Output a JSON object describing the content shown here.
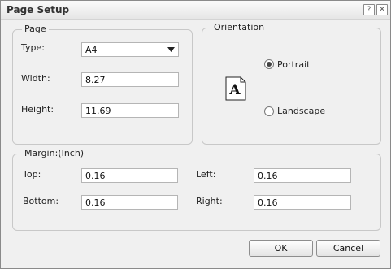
{
  "dialog": {
    "title": "Page Setup",
    "help_icon": "question-icon",
    "close_icon": "close-icon",
    "help_glyph": "?",
    "close_glyph": "✕"
  },
  "page": {
    "legend": "Page",
    "type_label": "Type:",
    "type_value": "A4",
    "type_options": [
      "A4"
    ],
    "width_label": "Width:",
    "width_value": "8.27",
    "height_label": "Height:",
    "height_value": "11.69"
  },
  "orientation": {
    "legend": "Orientation",
    "page_icon": "page-letter-a-icon",
    "portrait_label": "Portrait",
    "landscape_label": "Landscape",
    "selected": "Portrait"
  },
  "margin": {
    "legend": "Margin:(Inch)",
    "top_label": "Top:",
    "top_value": "0.16",
    "left_label": "Left:",
    "left_value": "0.16",
    "bottom_label": "Bottom:",
    "bottom_value": "0.16",
    "right_label": "Right:",
    "right_value": "0.16"
  },
  "buttons": {
    "ok": "OK",
    "cancel": "Cancel"
  }
}
